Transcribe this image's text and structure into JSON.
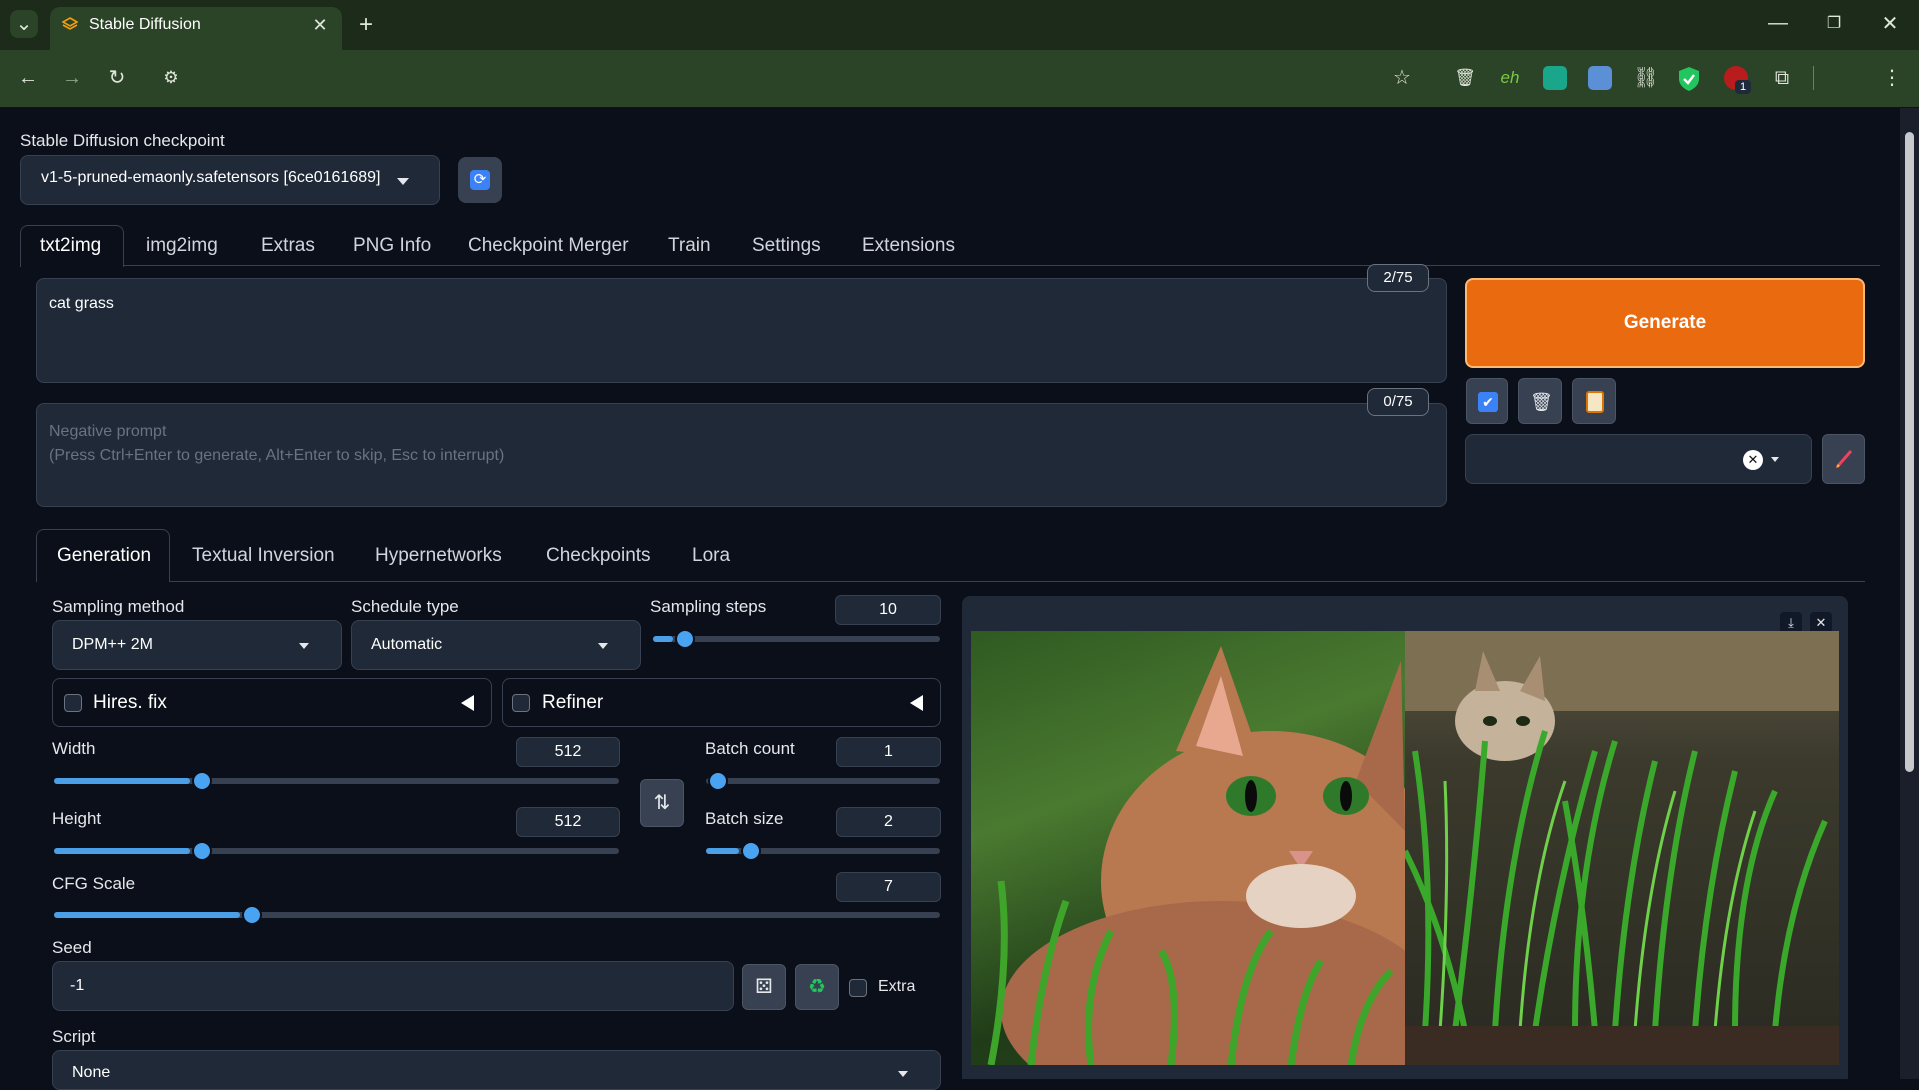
{
  "browser": {
    "tab_title": "Stable Diffusion",
    "new_tab": "+",
    "ext_badge": "1"
  },
  "checkpoint": {
    "label": "Stable Diffusion checkpoint",
    "value": "v1-5-pruned-emaonly.safetensors [6ce0161689]"
  },
  "main_tabs": [
    "txt2img",
    "img2img",
    "Extras",
    "PNG Info",
    "Checkpoint Merger",
    "Train",
    "Settings",
    "Extensions"
  ],
  "prompt": {
    "value": "cat grass",
    "token_count": "2/75"
  },
  "negative_prompt": {
    "placeholder": "Negative prompt\n(Press Ctrl+Enter to generate, Alt+Enter to skip, Esc to interrupt)",
    "token_count": "0/75"
  },
  "generate_label": "Generate",
  "sub_tabs": [
    "Generation",
    "Textual Inversion",
    "Hypernetworks",
    "Checkpoints",
    "Lora"
  ],
  "params": {
    "sampling_method_label": "Sampling method",
    "sampling_method": "DPM++ 2M",
    "schedule_type_label": "Schedule type",
    "schedule_type": "Automatic",
    "sampling_steps_label": "Sampling steps",
    "sampling_steps": "10",
    "sampling_steps_fraction": 0.07,
    "hires_label": "Hires. fix",
    "refiner_label": "Refiner",
    "width_label": "Width",
    "width": "512",
    "width_fraction": 0.24,
    "height_label": "Height",
    "height": "512",
    "height_fraction": 0.24,
    "batch_count_label": "Batch count",
    "batch_count": "1",
    "batch_count_fraction": 0.0,
    "batch_size_label": "Batch size",
    "batch_size": "2",
    "batch_size_fraction": 0.14,
    "cfg_label": "CFG Scale",
    "cfg": "7",
    "cfg_fraction": 0.21,
    "seed_label": "Seed",
    "seed": "-1",
    "extra_label": "Extra",
    "script_label": "Script",
    "script": "None"
  },
  "colors": {
    "generate": "#f97316",
    "accent": "#4aa3f0",
    "background": "#0b0f19"
  }
}
